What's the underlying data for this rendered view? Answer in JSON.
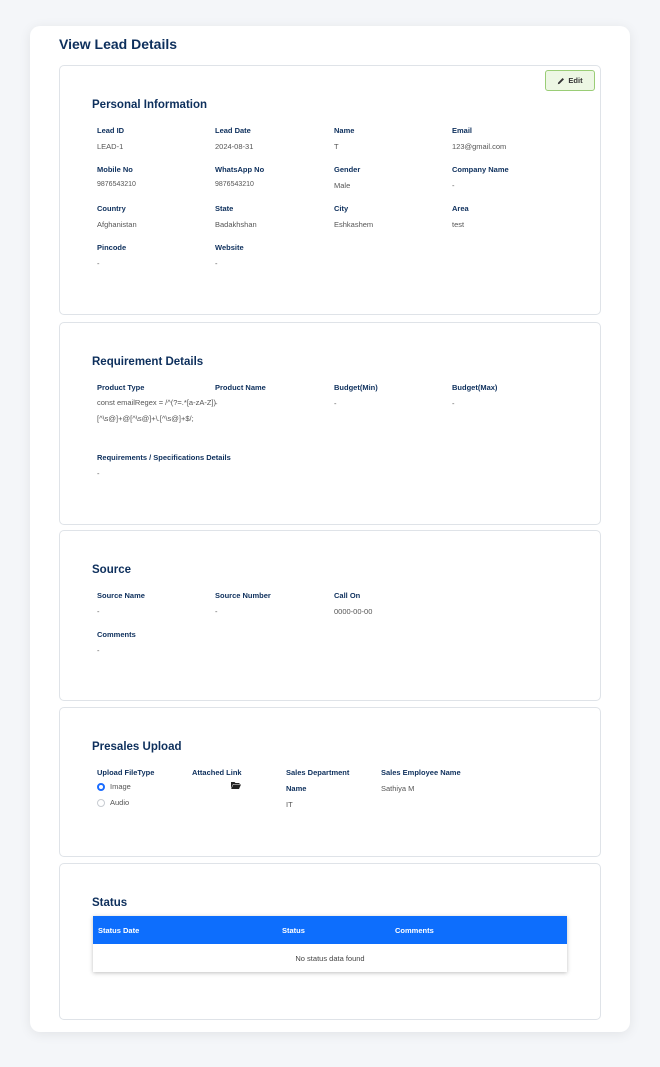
{
  "page": {
    "title": "View Lead Details"
  },
  "personal": {
    "title": "Personal Information",
    "edit_label": "Edit",
    "fields": {
      "lead_id": {
        "label": "Lead ID",
        "value": "LEAD-1"
      },
      "lead_date": {
        "label": "Lead Date",
        "value": "2024-08-31"
      },
      "name": {
        "label": "Name",
        "value": "T"
      },
      "email": {
        "label": "Email",
        "value": "123@gmail.com"
      },
      "mobile": {
        "label": "Mobile No",
        "value": "9876543210"
      },
      "whatsapp": {
        "label": "WhatsApp No",
        "value": "9876543210"
      },
      "gender": {
        "label": "Gender",
        "value": "Male"
      },
      "company": {
        "label": "Company Name",
        "value": "-"
      },
      "country": {
        "label": "Country",
        "value": "Afghanistan"
      },
      "state": {
        "label": "State",
        "value": "Badakhshan"
      },
      "city": {
        "label": "City",
        "value": "Eshkashem"
      },
      "area": {
        "label": "Area",
        "value": "test"
      },
      "pincode": {
        "label": "Pincode",
        "value": "-"
      },
      "website": {
        "label": "Website",
        "value": "-"
      }
    }
  },
  "requirement": {
    "title": "Requirement Details",
    "product_type": {
      "label": "Product Type",
      "value": "const emailRegex = /^(?=.*[a-zA-Z])[^\\s@]+@[^\\s@]+\\.[^\\s@]+$/;"
    },
    "product_name": {
      "label": "Product Name",
      "value": "-"
    },
    "budget_min": {
      "label": "Budget(Min)",
      "value": "-"
    },
    "budget_max": {
      "label": "Budget(Max)",
      "value": "-"
    },
    "specs": {
      "label": "Requirements / Specifications Details",
      "value": "-"
    }
  },
  "source": {
    "title": "Source",
    "source_name": {
      "label": "Source Name",
      "value": "-"
    },
    "source_number": {
      "label": "Source Number",
      "value": "-"
    },
    "call_on": {
      "label": "Call On",
      "value": "0000-00-00"
    },
    "comments": {
      "label": "Comments",
      "value": "-"
    }
  },
  "presales": {
    "title": "Presales Upload",
    "upload_label": "Upload FileType",
    "options": [
      "Image",
      "Audio"
    ],
    "selected": "Image",
    "attached_label": "Attached Link",
    "dept_label_1": "Sales Department",
    "dept_label_2": "Name",
    "dept_value": "IT",
    "employee_label": "Sales Employee Name",
    "employee_value": "Sathiya M"
  },
  "status": {
    "title": "Status",
    "columns": [
      "Status Date",
      "Status",
      "Comments"
    ],
    "empty_text": "No status data found"
  },
  "colors": {
    "accent": "#0d6efd",
    "heading": "#0d2f5c",
    "edit_bg": "#edf7e4",
    "edit_border": "#9acd76"
  }
}
